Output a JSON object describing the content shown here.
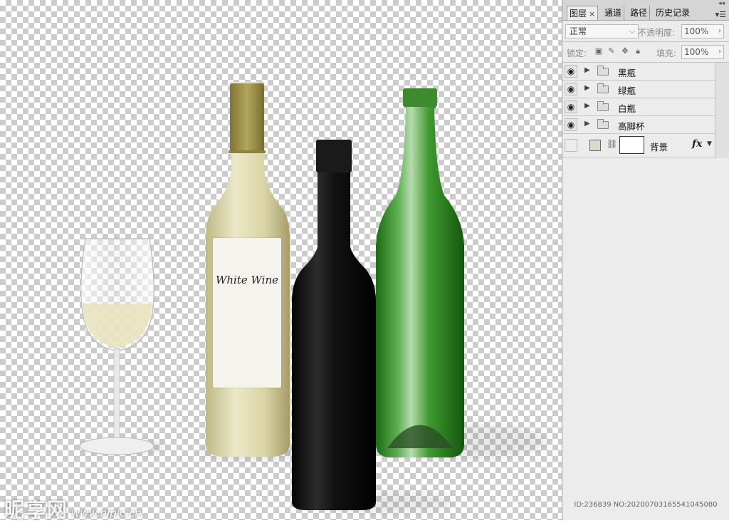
{
  "panel": {
    "tabs": {
      "layers": "图层",
      "layers_close": "×",
      "channels": "通道",
      "paths": "路径",
      "history": "历史记录"
    },
    "blend_mode": "正常",
    "opacity_label": "不透明度:",
    "opacity_value": "100%",
    "lock_label": "锁定:",
    "fill_label": "填充:",
    "fill_value": "100%",
    "layers": [
      {
        "name": "黑瓶",
        "type": "group",
        "visible": true
      },
      {
        "name": "绿瓶",
        "type": "group",
        "visible": true
      },
      {
        "name": "白瓶",
        "type": "group",
        "visible": true
      },
      {
        "name": "高脚杯",
        "type": "group",
        "visible": true
      }
    ],
    "background_layer": {
      "name": "背景",
      "fx": "fx"
    }
  },
  "canvas": {
    "label_title": "White Wine",
    "watermark": "昵享网",
    "watermark_url": "www.nipic.cn",
    "id_text": "ID:236839 NO:20200703165541045080"
  },
  "icons": {
    "eye": "eye-icon",
    "folder": "folder-icon",
    "expand": "triangle-right-icon",
    "link": "chain-link-icon",
    "panel_menu": "panel-menu-icon"
  },
  "colors": {
    "white_bottle": "#d8d3a4",
    "black_bottle": "#161616",
    "green_bottle": "#2a8c1f",
    "cap_gold": "#a69a4d",
    "panel_bg": "#ececec"
  }
}
